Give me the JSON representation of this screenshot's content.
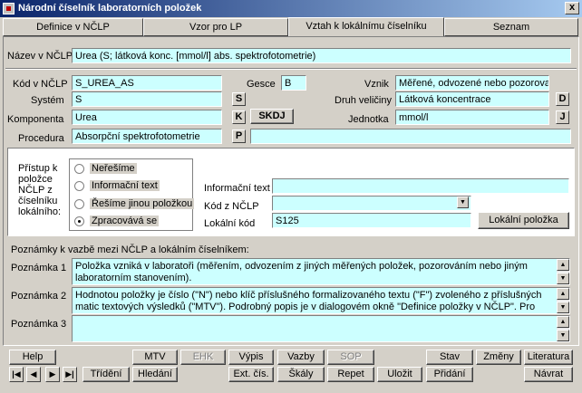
{
  "window": {
    "title": "Národní číselník laboratorních položek",
    "close_glyph": "x"
  },
  "tabs": [
    {
      "label": "Definice v NČLP",
      "ul": "D"
    },
    {
      "label": "Vzor pro LP",
      "ul": "o"
    },
    {
      "label": "Vztah k lokálnímu číselníku",
      "ul": "l"
    },
    {
      "label": "Seznam",
      "ul": "S"
    }
  ],
  "form": {
    "nazev_label": "Název v NČLP",
    "nazev_value": "Urea (S; látková konc. [mmol/l] abs. spektrofotometrie)",
    "kod_label": "Kód v NČLP",
    "kod_value": "S_UREA_AS",
    "gesce_label": "Gesce",
    "gesce_value": "B",
    "vznik_label": "Vznik",
    "vznik_value": "Měřené, odvozené nebo pozorované v",
    "system_label": "Systém",
    "system_value": "S",
    "system_btn": "S",
    "druh_label": "Druh veličiny",
    "druh_value": "Látková koncentrace",
    "druh_btn": "D",
    "komponenta_label": "Komponenta",
    "komponenta_value": "Urea",
    "komponenta_btn": "K",
    "skdj_btn": "SKDJ",
    "jednotka_label": "Jednotka",
    "jednotka_value": "mmol/l",
    "jednotka_btn": "J",
    "procedura_label": "Procedura",
    "procedura_value": "Absorpční spektrofotometrie",
    "procedura_btn": "P",
    "procedura_extra": ""
  },
  "access": {
    "label": "Přístup k položce NČLP z číselníku lokálního:",
    "options": [
      {
        "label": "Neřešíme",
        "checked": false
      },
      {
        "label": "Informační text",
        "checked": false
      },
      {
        "label": "Řešíme jinou položkou",
        "checked": false
      },
      {
        "label": "Zpracovává se",
        "checked": true
      }
    ],
    "info_label": "Informační text",
    "info_value": "",
    "kodz_label": "Kód z NČLP",
    "kodz_value": "",
    "lokalni_label": "Lokální kód",
    "lokalni_value": "S125",
    "lokalni_btn": "Lokální položka"
  },
  "notes": {
    "heading": "Poznámky k vazbě mezi NČLP a lokálním číselníkem:",
    "items": [
      {
        "label": "Poznámka 1",
        "text": "Položka vzniká v laboratoři (měřením, odvozením z jiných měřených položek, pozorováním nebo jiným laboratorním stanovením)."
      },
      {
        "label": "Poznámka 2",
        "text": "Hodnotou položky je číslo (\"N\") nebo klíč příslušného formalizovaného textu (\"F\") zvoleného z příslušných matic textových výsledků (\"MTV\"). Podrobný popis je v dialogovém okně \"Definice položky v NČLP\". Pro tuto položku si může uživatel"
      },
      {
        "label": "Poznámka 3",
        "text": ""
      }
    ]
  },
  "toolbar": {
    "help": "Help",
    "mtv": "MTV",
    "ehk": "EHK",
    "vypis": "Výpis",
    "vazby": "Vazby",
    "sop": "SOP",
    "stav": "Stav",
    "zmeny": "Změny",
    "literatura": "Literatura",
    "trideni": "Třídění",
    "hledani": "Hledání",
    "ext": "Ext. čís.",
    "skaly": "Škály",
    "repet": "Repet",
    "ulozit": "Uložit",
    "pridani": "Přidání",
    "navrat": "Návrat"
  },
  "nav": {
    "first": "|◀",
    "prev": "◀",
    "next": "▶",
    "last": "▶|"
  }
}
